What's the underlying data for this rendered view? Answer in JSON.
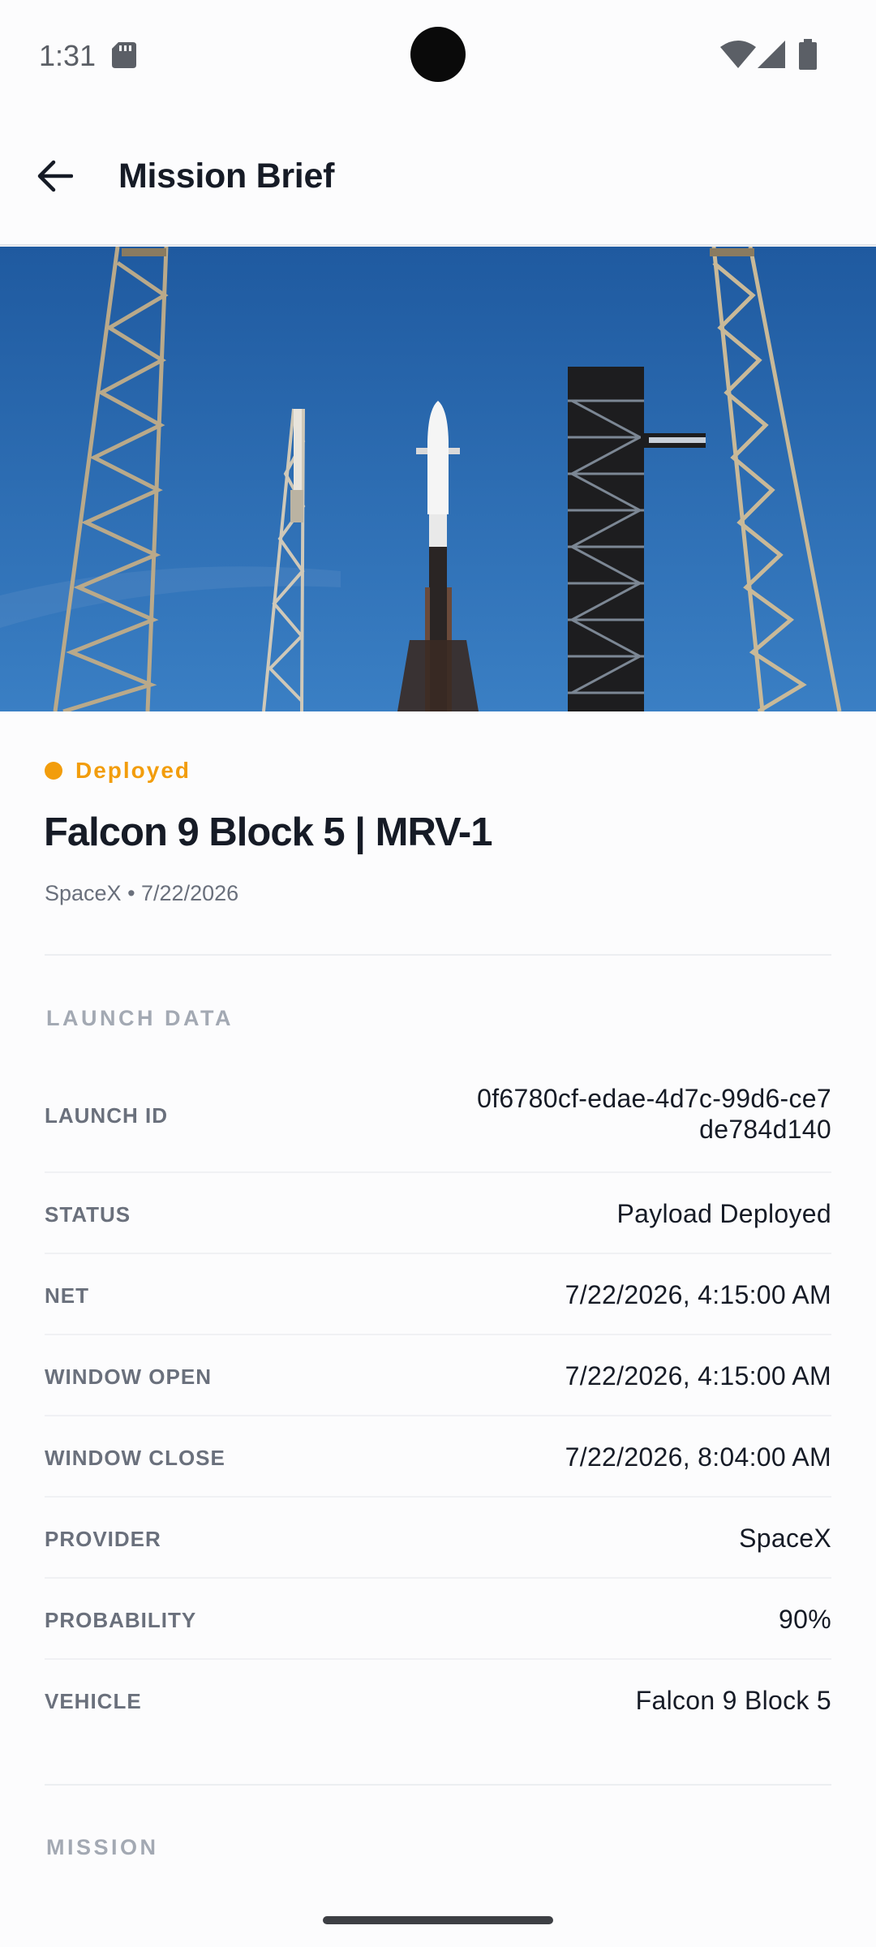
{
  "status_bar": {
    "time": "1:31"
  },
  "app_bar": {
    "title": "Mission Brief"
  },
  "launch": {
    "status_badge": "Deployed",
    "status_color": "#f29d0c",
    "title": "Falcon 9 Block 5 | MRV-1",
    "subtitle": "SpaceX • 7/22/2026"
  },
  "launch_data": {
    "header": "LAUNCH DATA",
    "rows": [
      {
        "label": "LAUNCH ID",
        "value_line1": "0f6780cf-edae-4d7c-99d6-ce7",
        "value_line2": "de784d140"
      },
      {
        "label": "STATUS",
        "value": "Payload Deployed"
      },
      {
        "label": "NET",
        "value": "7/22/2026, 4:15:00 AM"
      },
      {
        "label": "WINDOW OPEN",
        "value": "7/22/2026, 4:15:00 AM"
      },
      {
        "label": "WINDOW CLOSE",
        "value": "7/22/2026, 8:04:00 AM"
      },
      {
        "label": "PROVIDER",
        "value": "SpaceX"
      },
      {
        "label": "PROBABILITY",
        "value": "90%"
      },
      {
        "label": "VEHICLE",
        "value": "Falcon 9 Block 5"
      }
    ]
  },
  "mission_section": {
    "header": "MISSION"
  },
  "icons": {
    "back": "arrow-left-icon",
    "sd_card": "sd-card-icon",
    "wifi": "wifi-icon",
    "signal": "cellular-signal-icon",
    "battery": "battery-icon"
  }
}
